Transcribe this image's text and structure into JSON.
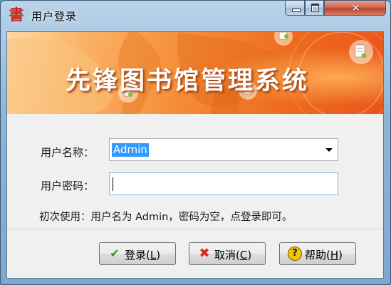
{
  "window": {
    "title": "用户登录",
    "app_icon_glyph": "書",
    "app_icon_name": "book-app-icon",
    "controls": {
      "minimize": "minimize-icon",
      "maximize": "maximize-icon",
      "close": "close-icon",
      "close_glyph": "✕"
    }
  },
  "banner": {
    "title": "先锋图书馆管理系统",
    "decorative_icons": [
      "document-icon",
      "document-icon",
      "document-icon",
      "document-icon"
    ]
  },
  "form": {
    "username_label": "用户名称：",
    "username_value": "Admin",
    "username_options_selected": "Admin",
    "password_label": "用户密码：",
    "password_value": "",
    "hint": "初次使用：用户名为 Admin，密码为空，点登录即可。"
  },
  "buttons": {
    "login": {
      "text": "登录(",
      "key": "L",
      "tail": ")",
      "icon": "checkmark-icon",
      "glyph": "✔"
    },
    "cancel": {
      "text": "取消(",
      "key": "C",
      "tail": ")",
      "icon": "cross-icon",
      "glyph": "✖"
    },
    "help": {
      "text": "帮助(",
      "key": "H",
      "tail": ")",
      "icon": "help-icon",
      "glyph": "?"
    }
  },
  "colors": {
    "banner_orange": "#ee6a1d",
    "selection_blue": "#3399ff",
    "close_red": "#c0432b"
  }
}
